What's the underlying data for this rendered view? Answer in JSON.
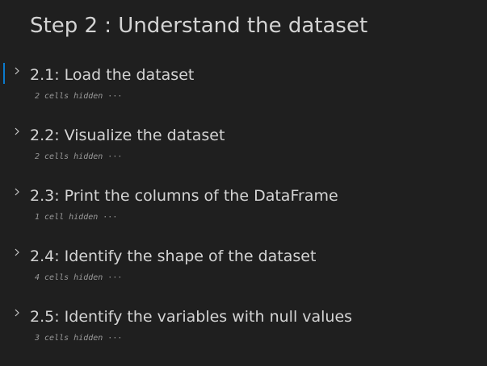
{
  "notebook": {
    "heading": "Step 2 : Understand the dataset",
    "sections": [
      {
        "title": "2.1: Load the dataset",
        "hidden": "2 cells hidden",
        "ellipsis": "···",
        "focused": true
      },
      {
        "title": "2.2: Visualize the dataset",
        "hidden": "2 cells hidden",
        "ellipsis": "···",
        "focused": false
      },
      {
        "title": "2.3: Print the columns of the DataFrame",
        "hidden": "1 cell hidden",
        "ellipsis": "···",
        "focused": false
      },
      {
        "title": "2.4: Identify the shape of the dataset",
        "hidden": "4 cells hidden",
        "ellipsis": "···",
        "focused": false
      },
      {
        "title": "2.5: Identify the variables with null values",
        "hidden": "3 cells hidden",
        "ellipsis": "···",
        "focused": false
      }
    ]
  },
  "colors": {
    "background": "#1f1f1f",
    "text": "#d4d4d4",
    "muted": "#9a9a9a",
    "focus_accent": "#0a7acc"
  },
  "icons": {
    "collapse_toggle": "chevron-right-icon"
  }
}
